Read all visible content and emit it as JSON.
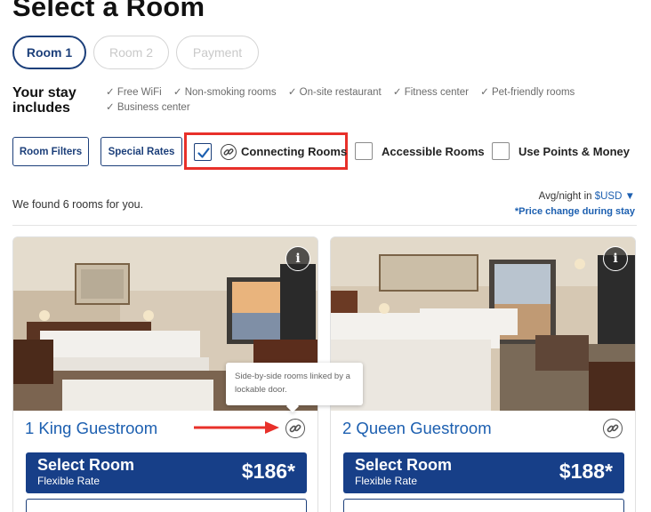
{
  "page": {
    "title": "Select a Room"
  },
  "steps": [
    {
      "label": "Room 1",
      "active": true
    },
    {
      "label": "Room 2",
      "active": false
    },
    {
      "label": "Payment",
      "active": false
    }
  ],
  "stay": {
    "title": "Your stay includes",
    "amenities": [
      "✓ Free WiFi",
      "✓ Non-smoking rooms",
      "✓ On-site restaurant",
      "✓ Fitness center",
      "✓ Pet-friendly rooms",
      "✓ Business center"
    ]
  },
  "filters": {
    "room_filters_label": "Room Filters",
    "special_rates_label": "Special Rates",
    "options": [
      {
        "label": "Connecting Rooms",
        "checked": true,
        "icon": "link-icon"
      },
      {
        "label": "Accessible Rooms",
        "checked": false
      },
      {
        "label": "Use Points & Money",
        "checked": false
      }
    ]
  },
  "results": {
    "found_text": "We found 6 rooms for you.",
    "avg_night_label": "Avg/night in",
    "currency": "$USD ▼",
    "price_note": "*Price change during stay"
  },
  "rooms": [
    {
      "name": "1 King Guestroom",
      "select_label": "Select Room",
      "rate": "Flexible Rate",
      "price": "$186*",
      "info_icon": "info-icon",
      "link_icon": "link-icon"
    },
    {
      "name": "2 Queen Guestroom",
      "select_label": "Select Room",
      "rate": "Flexible Rate",
      "price": "$188*",
      "info_icon": "info-icon",
      "link_icon": "link-icon"
    }
  ],
  "tooltip": {
    "text": "Side-by-side rooms linked by a lockable door."
  },
  "colors": {
    "brand_navy": "#173f88",
    "link_blue": "#1c5fb0",
    "highlight_red": "#e8302a"
  }
}
